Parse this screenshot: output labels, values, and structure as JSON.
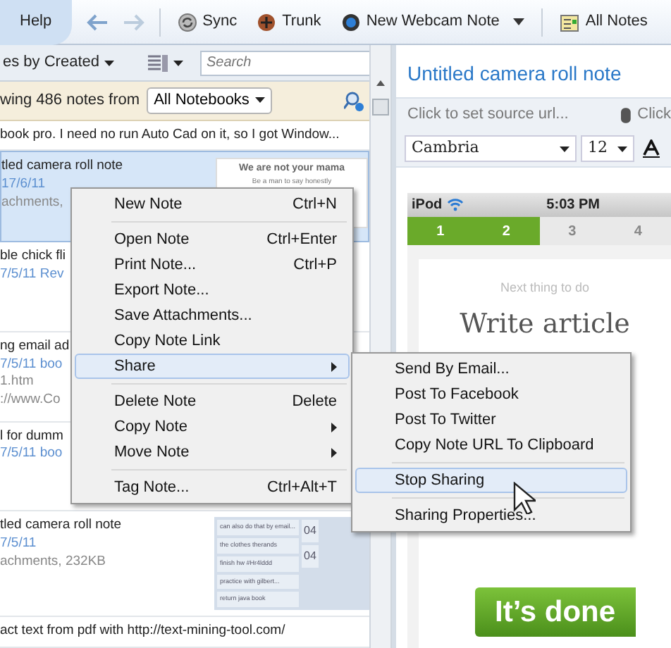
{
  "toolbar": {
    "menu_tab": "Help",
    "buttons": [
      {
        "label": "Sync",
        "kind": "sync"
      },
      {
        "label": "Trunk",
        "kind": "trunk"
      },
      {
        "label": "New Webcam Note",
        "kind": "webcam"
      },
      {
        "label": "All Notes",
        "kind": "notes"
      }
    ]
  },
  "note_list": {
    "sort_label": "es by Created",
    "search": {
      "placeholder": "Search"
    },
    "filter_text": "wing 486 notes from",
    "notebook": "All Notebooks",
    "notes": [
      {
        "title": "book pro. I need no run Auto Cad on it, so I got Window...",
        "selected": false
      },
      {
        "title": "tled camera roll note",
        "lines": [
          "17/6/11",
          "achments,"
        ],
        "selected": true,
        "thumb": {
          "kind": "poster",
          "texts": [
            "We are not your mama",
            "Be a man to say honestly"
          ]
        }
      },
      {
        "title": "ble chick fli",
        "lines": [
          "7/5/11  Rev"
        ],
        "selected": false
      },
      {
        "title": "ng email ad",
        "lines": [
          "7/5/11  boo",
          "1.htm",
          "://www.Co"
        ],
        "selected": false
      },
      {
        "title": "l for dumm",
        "lines": [
          "7/5/11  boo"
        ],
        "selected": false
      },
      {
        "title": "tled camera roll note",
        "lines": [
          "7/5/11",
          "achments,  232KB"
        ],
        "selected": false,
        "thumb": {
          "kind": "tasks",
          "texts": [
            "can also do that by email...",
            "the clothes therands",
            "finish hw #Hr4lddd",
            "practice with gilbert...",
            "return java book"
          ],
          "side": [
            "04",
            "04"
          ]
        }
      },
      {
        "title": "act text from pdf with http://text-mining-tool.com/",
        "selected": false
      }
    ]
  },
  "context_menu": [
    {
      "kind": "item",
      "label": "New Note",
      "shortcut": "Ctrl+N",
      "submenu": false,
      "selected": false
    },
    {
      "kind": "separator"
    },
    {
      "kind": "item",
      "label": "Open Note",
      "shortcut": "Ctrl+Enter",
      "submenu": false,
      "selected": false
    },
    {
      "kind": "item",
      "label": "Print Note...",
      "shortcut": "Ctrl+P",
      "submenu": false,
      "selected": false
    },
    {
      "kind": "item",
      "label": "Export Note...",
      "submenu": false,
      "selected": false
    },
    {
      "kind": "item",
      "label": "Save Attachments...",
      "submenu": false,
      "selected": false
    },
    {
      "kind": "item",
      "label": "Copy Note Link",
      "submenu": false,
      "selected": false
    },
    {
      "kind": "item",
      "label": "Share",
      "submenu": true,
      "selected": true
    },
    {
      "kind": "separator"
    },
    {
      "kind": "item",
      "label": "Delete Note",
      "shortcut": "Delete",
      "submenu": false,
      "selected": false
    },
    {
      "kind": "item",
      "label": "Copy Note",
      "submenu": true,
      "selected": false
    },
    {
      "kind": "item",
      "label": "Move Note",
      "submenu": true,
      "selected": false
    },
    {
      "kind": "separator"
    },
    {
      "kind": "item",
      "label": "Tag Note...",
      "shortcut": "Ctrl+Alt+T",
      "submenu": false,
      "selected": false
    }
  ],
  "share_menu": [
    {
      "kind": "item",
      "label": "Send By Email...",
      "selected": false
    },
    {
      "kind": "item",
      "label": "Post To Facebook",
      "selected": false
    },
    {
      "kind": "item",
      "label": "Post To Twitter",
      "selected": false
    },
    {
      "kind": "item",
      "label": "Copy Note URL To Clipboard",
      "selected": false
    },
    {
      "kind": "separator"
    },
    {
      "kind": "item",
      "label": "Stop Sharing",
      "selected": true
    },
    {
      "kind": "separator"
    },
    {
      "kind": "item",
      "label": "Sharing Properties...",
      "selected": false
    }
  ],
  "editor": {
    "title": "Untitled camera roll note",
    "source_placeholder": "Click to set source url...",
    "attach_label": "Click",
    "font": "Cambria",
    "size": "12",
    "content": {
      "device": "iPod",
      "time": "5:03 PM",
      "steps": [
        {
          "label": "1",
          "done": true
        },
        {
          "label": "2",
          "done": true
        },
        {
          "label": "3",
          "done": false
        },
        {
          "label": "4",
          "done": false
        }
      ],
      "caption": "Next thing to do",
      "headline": "Write article",
      "button": "It’s done"
    }
  }
}
